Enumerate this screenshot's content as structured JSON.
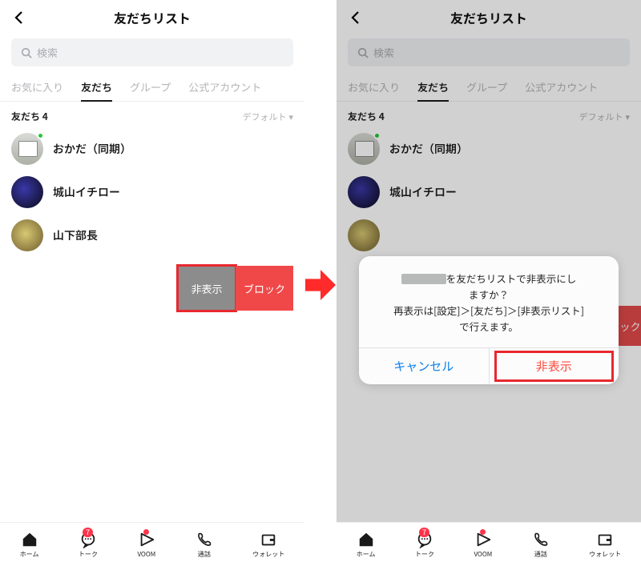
{
  "header": {
    "title": "友だちリスト"
  },
  "search": {
    "placeholder": "検索"
  },
  "tabs": [
    "お気に入り",
    "友だち",
    "グループ",
    "公式アカウント"
  ],
  "activeTab": 1,
  "section": {
    "label": "友だち 4",
    "sort": "デフォルト"
  },
  "friends": [
    {
      "name": "おかだ（同期）",
      "online": true,
      "avatarClass": "av1"
    },
    {
      "name": "城山イチロー",
      "online": false,
      "avatarClass": "av2"
    },
    {
      "name": "山下部長",
      "online": false,
      "avatarClass": "av3"
    }
  ],
  "swipe": {
    "hide": "非表示",
    "block": "ブロック"
  },
  "nav": [
    {
      "label": "ホーム",
      "icon": "home"
    },
    {
      "label": "トーク",
      "icon": "chat",
      "badge": "7"
    },
    {
      "label": "VOOM",
      "icon": "voom",
      "dot": true
    },
    {
      "label": "通話",
      "icon": "call"
    },
    {
      "label": "ウォレット",
      "icon": "wallet"
    }
  ],
  "dialog": {
    "line1a": "を友だちリストで非表示にし",
    "line1b": "ますか？",
    "line2": "再表示は[設定]＞[友だち]＞[非表示リスト]",
    "line3": "で行えます。",
    "cancel": "キャンセル",
    "confirm": "非表示"
  },
  "rightBlockText": "ロック"
}
